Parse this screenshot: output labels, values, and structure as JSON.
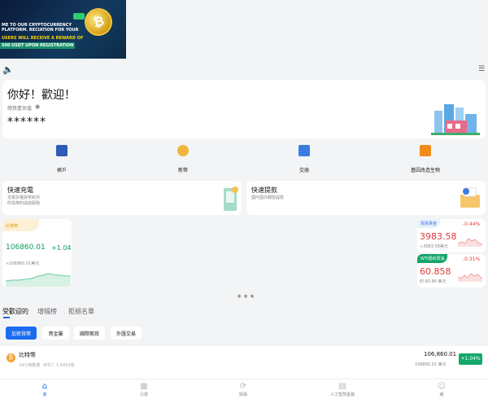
{
  "banner": {
    "line1": "ME TO OUR CRYPTOCURRENCY PLATFORM. RECIATION FOR YOUR",
    "line2": "USERS WILL RECEIVE A REWARD OF",
    "line3": "500 USDT UPON REGISTRATION"
  },
  "welcome": {
    "greeting": "你好！歡迎！",
    "asset_label": "總資產估值",
    "hidden_balance": "******"
  },
  "quick_menu": [
    {
      "label": "帳戶",
      "icon": "bank-icon",
      "color": "#2e5ab8"
    },
    {
      "label": "新幣",
      "icon": "coins-icon",
      "color": "#f0b43a"
    },
    {
      "label": "交換",
      "icon": "exchange-icon",
      "color": "#3a7be0"
    },
    {
      "label": "基因改造生物",
      "icon": "growth-chart-icon",
      "color": "#f08a1a"
    }
  ],
  "deposit": {
    "title": "快速充電",
    "line1": "支援多種貨幣和你",
    "line2": "所需幣的儲值服務"
  },
  "withdraw": {
    "title": "快速提款",
    "line1": "國內國外都能提款"
  },
  "btc_card": {
    "tag": "比特幣",
    "price": "106860.01",
    "change": "+1.04%",
    "usd": "≈106860.01美元"
  },
  "gold": {
    "tag": "現貨黃金",
    "change": "-0.44%",
    "price": "3983.58",
    "sub": "≈3983.58美元"
  },
  "oil": {
    "tag": "WTI紐約原油",
    "change": "-0.31%",
    "price": "60.858",
    "sub": "約 60.86 美元"
  },
  "tabs": [
    {
      "label": "受歡迎的",
      "active": true
    },
    {
      "label": "增幅榜",
      "active": false
    },
    {
      "label": "拒絕名單",
      "active": false
    }
  ],
  "chips": [
    {
      "label": "加密貨幣",
      "active": true
    },
    {
      "label": "貴金屬",
      "active": false
    },
    {
      "label": "國際期貨",
      "active": false
    },
    {
      "label": "外匯交易",
      "active": false
    }
  ],
  "market_row": {
    "name": "比特幣",
    "volume": "24小時數量（BTC）1.6455億",
    "price": "106,860.01",
    "usd": "106860.01 美元",
    "change": "+1.04%"
  },
  "bottom_nav": [
    {
      "label": "家",
      "icon": "home-icon",
      "active": true
    },
    {
      "label": "引號",
      "icon": "quotes-icon",
      "active": false
    },
    {
      "label": "興易",
      "icon": "trade-icon",
      "active": false
    },
    {
      "label": "人工智慧金融",
      "icon": "ai-finance-icon",
      "active": false
    },
    {
      "label": "錫",
      "icon": "profile-icon",
      "active": false
    }
  ],
  "colors": {
    "accent": "#1a6cf0",
    "up": "#0a9d5a",
    "down": "#e03a3a"
  }
}
